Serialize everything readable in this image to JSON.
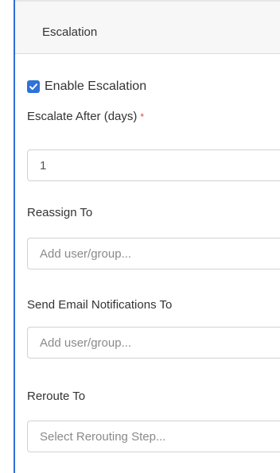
{
  "section": {
    "title": "Escalation"
  },
  "enable_escalation": {
    "checked": true,
    "label": "Enable Escalation"
  },
  "escalate_after": {
    "label": "Escalate After (days)",
    "required_marker": "*",
    "value": "1"
  },
  "reassign_to": {
    "label": "Reassign To",
    "placeholder": "Add user/group..."
  },
  "send_email": {
    "label": "Send Email Notifications To",
    "placeholder": "Add user/group..."
  },
  "reroute_to": {
    "label": "Reroute To",
    "placeholder": "Select Rerouting Step..."
  },
  "colors": {
    "accent": "#2f72d8",
    "required": "#e04646",
    "header_bg": "#f7f7f7"
  }
}
